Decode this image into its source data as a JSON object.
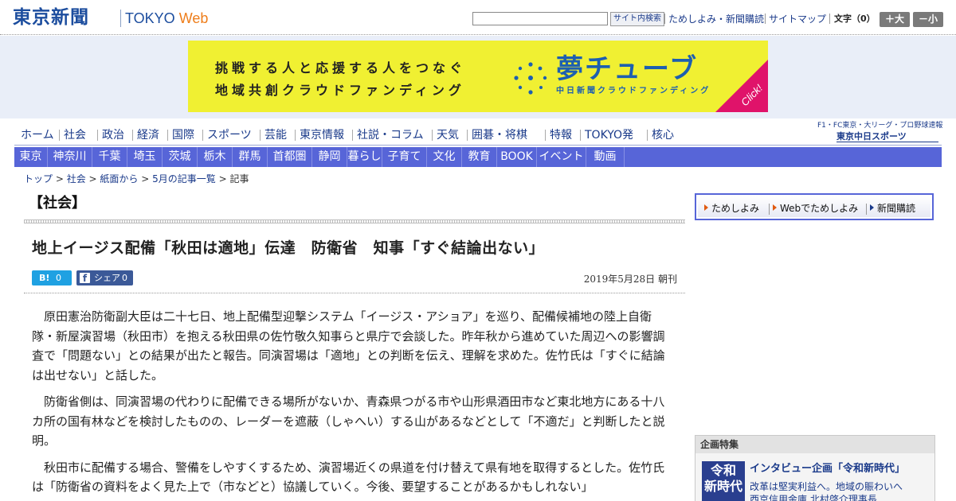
{
  "header": {
    "logo_jp": "東京新聞",
    "logo_en": "TOKYO",
    "logo_web": "Web",
    "search_button": "サイト内検索",
    "links": [
      "ためしよみ・新聞購読",
      "サイトマップ"
    ],
    "font_size_label": "文字（0）",
    "font_larger": "＋大",
    "font_smaller": "－小"
  },
  "ad": {
    "line1": "挑戦する人と応援する人をつなぐ",
    "line2": "地域共創クラウドファンディング",
    "brand": "夢チューブ",
    "brand_sub": "中日新聞クラウドファンディング",
    "click": "Click!",
    "accent": "#f0f032"
  },
  "nav": {
    "primary": [
      "ホーム",
      "社会",
      "政治",
      "経済",
      "国際",
      "スポーツ",
      "芸能",
      "東京情報",
      "社説・コラム",
      "天気",
      "囲碁・将棋",
      "特報",
      "TOKYO発",
      "核心"
    ],
    "sports_tagline": "F1・FC東京・大リーグ・プロ野球速報",
    "sports_logo": "東京中日スポーツ",
    "regional": [
      "東京",
      "神奈川",
      "千葉",
      "埼玉",
      "茨城",
      "栃木",
      "群馬",
      "首都圏",
      "静岡",
      "暮らし",
      "子育て",
      "文化",
      "教育",
      "BOOK",
      "イベント",
      "動画"
    ]
  },
  "breadcrumb": {
    "items": [
      "トップ",
      "社会",
      "紙面から",
      "5月の記事一覧"
    ],
    "current": "記事",
    "sep": " > "
  },
  "section": {
    "title": "【社会】"
  },
  "article": {
    "headline": "地上イージス配備「秋田は適地」伝達　防衛省　知事「すぐ結論出ない」",
    "share_hatena_label": "B!",
    "share_hatena_count": "0",
    "share_fb_icon": "f",
    "share_fb_label": "シェア",
    "share_fb_count": "0",
    "date": "2019年5月28日 朝刊",
    "paragraphs": [
      "原田憲治防衛副大臣は二十七日、地上配備型迎撃システム「イージス・アショア」を巡り、配備候補地の陸上自衛隊・新屋演習場（秋田市）を抱える秋田県の佐竹敬久知事らと県庁で会談した。昨年秋から進めていた周辺への影響調査で「問題ない」との結果が出たと報告。同演習場は「適地」との判断を伝え、理解を求めた。佐竹氏は「すぐに結論は出せない」と話した。",
      "防衛省側は、同演習場の代わりに配備できる場所がないか、青森県つがる市や山形県酒田市など東北地方にある十八カ所の国有林などを検討したものの、レーダーを遮蔽（しゃへい）する山があるなどとして「不適だ」と判断したと説明。",
      "秋田市に配備する場合、警備をしやすくするため、演習場近くの県道を付け替えて県有地を取得するとした。佐竹氏は「防衛省の資料をよく見た上で（市などと）協議していく。今後、要望することがあるかもしれない」"
    ]
  },
  "subscribe": {
    "items": [
      "ためしよみ",
      "Webでためしよみ",
      "新聞購読"
    ]
  },
  "feature": {
    "heading": "企画特集",
    "thumb_line1": "令和",
    "thumb_line2": "新時代",
    "title": "インタビュー企画「令和新時代」",
    "desc1": "改革は堅実利益へ。地域の賑わいへ",
    "desc2": "西京信用金庫 北村啓介理事長"
  }
}
